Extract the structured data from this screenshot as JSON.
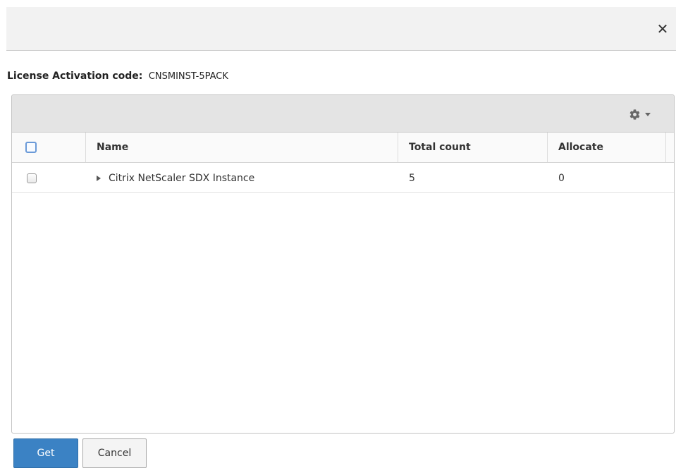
{
  "dialog": {
    "close_glyph": "✕"
  },
  "license": {
    "label": "License Activation code:",
    "code": "CNSMINST-5PACK"
  },
  "grid": {
    "toolbar": {
      "settings_icon": "gear-icon",
      "dropdown_icon": "caret-down-icon"
    },
    "columns": [
      "Name",
      "Total count",
      "Allocate"
    ],
    "rows": [
      {
        "name": "Citrix NetScaler SDX Instance",
        "total_count": "5",
        "allocate": "0",
        "checked": false,
        "expanded": false
      }
    ]
  },
  "footer": {
    "get_label": "Get",
    "cancel_label": "Cancel"
  },
  "colors": {
    "primary_button": "#3b82c4",
    "header_bg": "#f2f2f2",
    "toolbar_bg": "#e4e4e4"
  }
}
